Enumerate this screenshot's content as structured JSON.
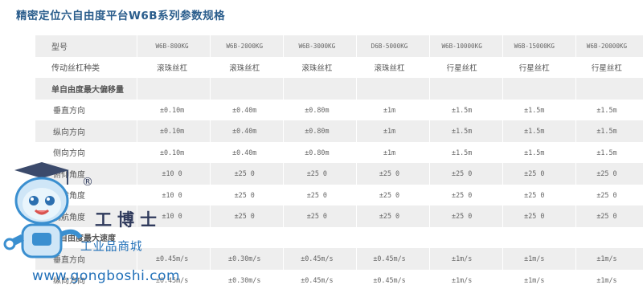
{
  "page": {
    "title": "精密定位六自由度平台W6B系列参数规格"
  },
  "table": {
    "rows": [
      {
        "label": "型号",
        "style": "model",
        "shade": true,
        "values": [
          "W6B-800KG",
          "W6B-2000KG",
          "W6B-3000KG",
          "D6B-5000KG",
          "W6B-10000KG",
          "W6B-15000KG",
          "W6B-20000KG"
        ]
      },
      {
        "label": "传动丝杠种类",
        "style": "text",
        "shade": false,
        "values": [
          "滚珠丝杠",
          "滚珠丝杠",
          "滚珠丝杠",
          "滚珠丝杠",
          "行星丝杠",
          "行星丝杠",
          "行星丝杠"
        ]
      },
      {
        "label": "单自由度最大偏移量",
        "style": "header",
        "shade": true,
        "values": [
          "",
          "",
          "",
          "",
          "",
          "",
          ""
        ]
      },
      {
        "label": "垂直方向",
        "style": "num",
        "shade": false,
        "values": [
          "±0.10m",
          "±0.40m",
          "±0.80m",
          "±1m",
          "±1.5m",
          "±1.5m",
          "±1.5m"
        ]
      },
      {
        "label": "纵向方向",
        "style": "num",
        "shade": true,
        "values": [
          "±0.10m",
          "±0.40m",
          "±0.80m",
          "±1m",
          "±1.5m",
          "±1.5m",
          "±1.5m"
        ]
      },
      {
        "label": "侧向方向",
        "style": "num",
        "shade": false,
        "values": [
          "±0.10m",
          "±0.40m",
          "±0.80m",
          "±1m",
          "±1.5m",
          "±1.5m",
          "±1.5m"
        ]
      },
      {
        "label": "俯仰角度",
        "style": "num",
        "shade": true,
        "values": [
          "±10 0",
          "±25 0",
          "±25 0",
          "±25 0",
          "±25 0",
          "±25 0",
          "±25 0"
        ]
      },
      {
        "label": "滚转角度",
        "style": "num",
        "shade": false,
        "values": [
          "±10 0",
          "±25 0",
          "±25 0",
          "±25 0",
          "±25 0",
          "±25 0",
          "±25 0"
        ]
      },
      {
        "label": "偏航角度",
        "style": "num",
        "shade": true,
        "values": [
          "±10 0",
          "±25 0",
          "±25 0",
          "±25 0",
          "±25 0",
          "±25 0",
          "±25 0"
        ]
      },
      {
        "label": "单自由度最大速度",
        "style": "header",
        "shade": false,
        "values": [
          "",
          "",
          "",
          "",
          "",
          "",
          ""
        ]
      },
      {
        "label": "垂直方向",
        "style": "num",
        "shade": true,
        "values": [
          "±0.45m/s",
          "±0.30m/s",
          "±0.45m/s",
          "±0.45m/s",
          "±1m/s",
          "±1m/s",
          "±1m/s"
        ]
      },
      {
        "label": "纵向方向",
        "style": "num",
        "shade": false,
        "values": [
          "±0.45m/s",
          "±0.30m/s",
          "±0.45m/s",
          "±0.45m/s",
          "±1m/s",
          "±1m/s",
          "±1m/s"
        ]
      }
    ]
  },
  "watermark": {
    "brand": "工博士",
    "registered": "®",
    "tagline": "工业品商城",
    "url": "www.gongboshi.com",
    "mascot": "robot-mascot-icon"
  },
  "colors": {
    "title": "#2a5d8c",
    "shade": "#eeeeee",
    "watermark_blue": "#1f6fb8"
  }
}
